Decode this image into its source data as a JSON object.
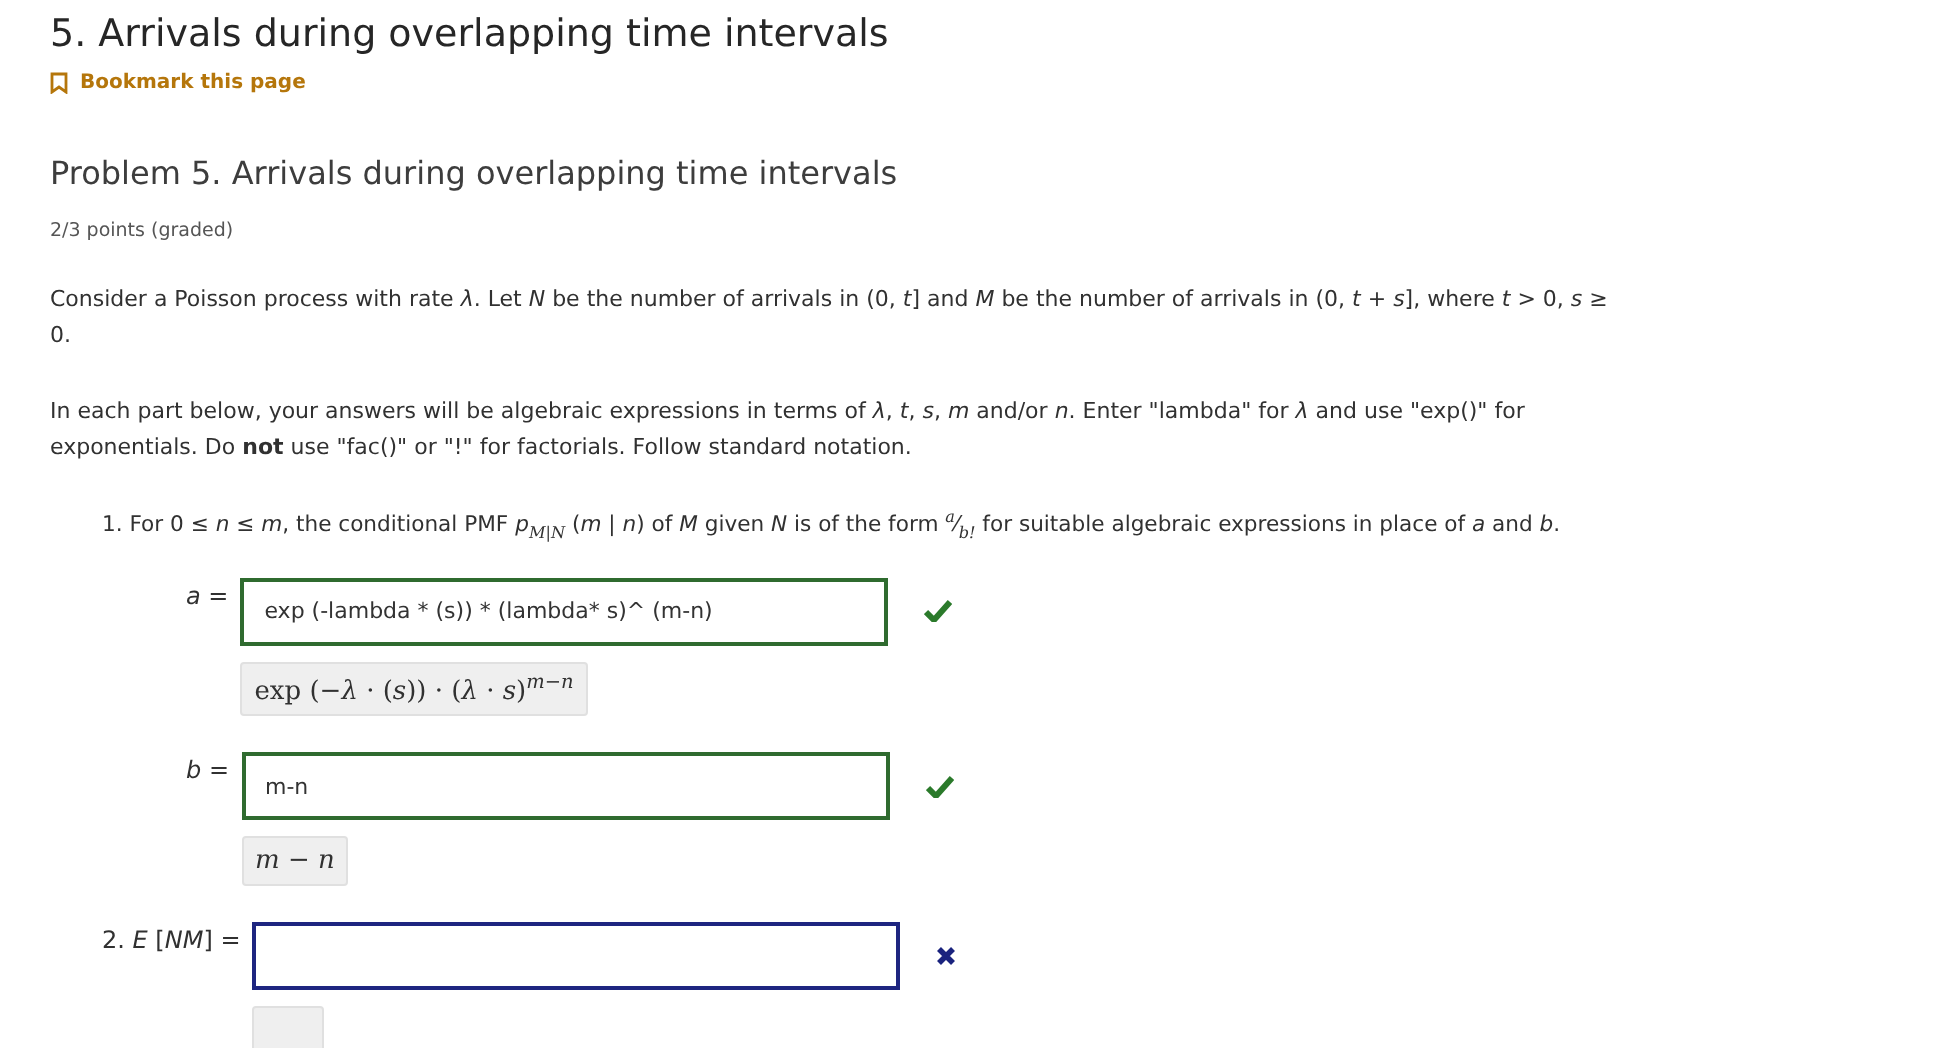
{
  "title": "5. Arrivals during overlapping time intervals",
  "bookmark": "Bookmark this page",
  "problem": {
    "title": "Problem 5. Arrivals during overlapping time intervals",
    "points": "2/3 points (graded)",
    "items": [
      {
        "kind": "text",
        "text": "Consider a Poisson process with rate *λ*. Let *N* be the number of arrivals in (0, *t*] and *M* be the number of arrivals in (0, *t* + *s*], where *t* > 0, *s* ≥ 0."
      },
      {
        "kind": "text",
        "text": "In each part below, your answers will be algebraic expressions in terms of *λ*, *t*, *s*, *m* and/or *n*. Enter \"lambda\" for *λ* and use \"exp()\" for exponentials. Do **not** use \"fac()\" or \"!\" for factorials. Follow standard notation."
      },
      {
        "kind": "text",
        "text": "1. For 0 ≤ *n* ≤ *m*, the conditional PMF *p*$_{M|N}$ (*m* | *n*) of *M* given *N* is of the form $^{a}$⁄$_{b!}$ for suitable algebraic expressions in place of *a* and *b*."
      },
      {
        "kind": "answer",
        "label": "*a* =",
        "value": "exp (-lambda * (s)) * (lambda* s)^ (m-n)",
        "preview": "exp (−*λ* · (*s*)) · (*λ* · *s*)$^{m−n}$",
        "correct": true
      },
      {
        "kind": "answer",
        "label": "*b* =",
        "value": "m-n",
        "preview": "*m* − *n*",
        "correct": true
      },
      {
        "kind": "answer",
        "label": "2. *E* [*NM*] =",
        "correct": false
      }
    ]
  }
}
